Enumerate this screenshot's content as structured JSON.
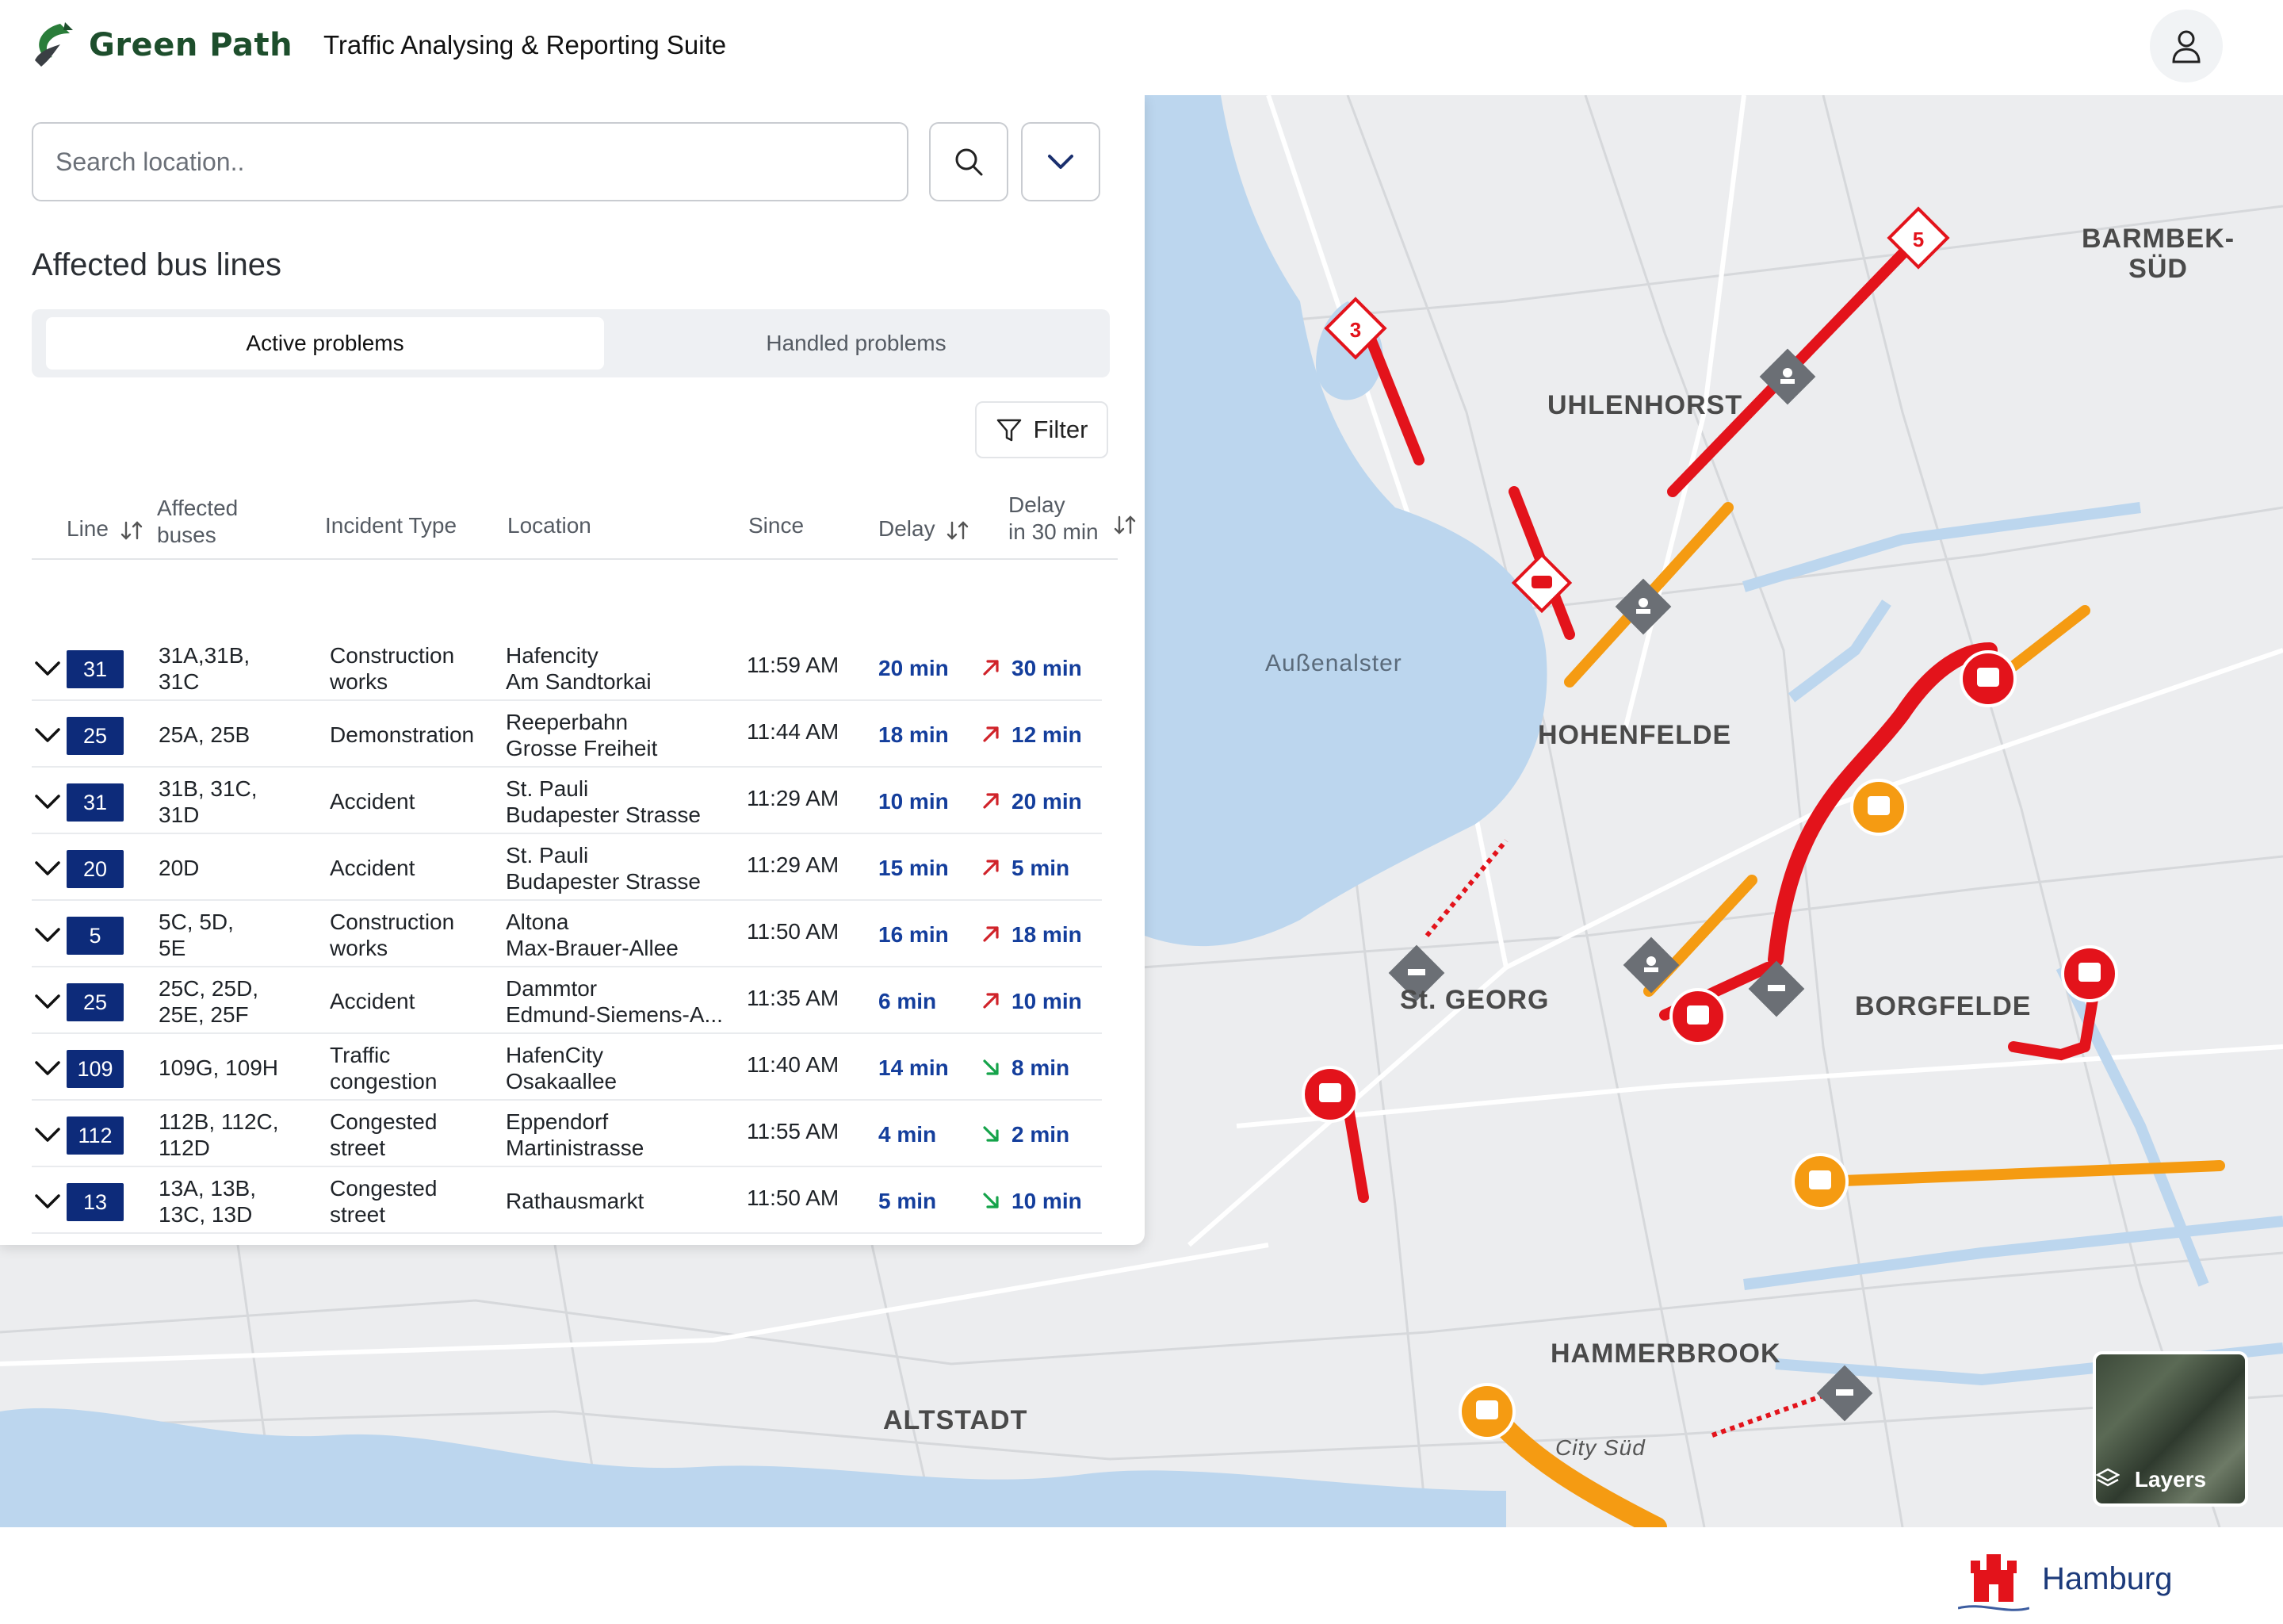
{
  "app": {
    "brand": "Green Path",
    "suite_title": "Traffic Analysing & Reporting Suite"
  },
  "search": {
    "placeholder": "Search location.."
  },
  "panel": {
    "title": "Affected bus lines",
    "tabs": [
      {
        "label": "Active problems",
        "active": true
      },
      {
        "label": "Handled problems",
        "active": false
      }
    ],
    "filter_label": "Filter"
  },
  "table": {
    "headers": {
      "line": "Line",
      "affected": "Affected\nbuses",
      "incident": "Incident Type",
      "location": "Location",
      "since": "Since",
      "delay": "Delay",
      "delay30": "Delay\nin 30 min"
    },
    "rows": [
      {
        "line": "31",
        "affected": "31A,31B,\n31C",
        "incident": "Construction\nworks",
        "location": "Hafencity\nAm Sandtorkai",
        "since": "11:59 AM",
        "delay": "20 min",
        "trend": "up",
        "delay30": "30 min"
      },
      {
        "line": "25",
        "affected": "25A, 25B",
        "incident": "Demonstration",
        "location": "Reeperbahn\nGrosse Freiheit",
        "since": "11:44 AM",
        "delay": "18 min",
        "trend": "up",
        "delay30": "12 min"
      },
      {
        "line": "31",
        "affected": "31B, 31C,\n31D",
        "incident": "Accident",
        "location": "St. Pauli\nBudapester Strasse",
        "since": "11:29 AM",
        "delay": "10 min",
        "trend": "up",
        "delay30": "20 min"
      },
      {
        "line": "20",
        "affected": "20D",
        "incident": "Accident",
        "location": "St. Pauli\nBudapester Strasse",
        "since": "11:29 AM",
        "delay": "15 min",
        "trend": "up",
        "delay30": "5 min"
      },
      {
        "line": "5",
        "affected": "5C, 5D,\n5E",
        "incident": "Construction\nworks",
        "location": "Altona\nMax-Brauer-Allee",
        "since": "11:50 AM",
        "delay": "16 min",
        "trend": "up",
        "delay30": "18 min"
      },
      {
        "line": "25",
        "affected": "25C, 25D,\n25E, 25F",
        "incident": "Accident",
        "location": "Dammtor\nEdmund-Siemens-A...",
        "since": "11:35 AM",
        "delay": "6 min",
        "trend": "up",
        "delay30": "10 min"
      },
      {
        "line": "109",
        "affected": "109G, 109H",
        "incident": "Traffic\ncongestion",
        "location": "HafenCity\nOsakaallee",
        "since": "11:40 AM",
        "delay": "14 min",
        "trend": "down",
        "delay30": "8 min"
      },
      {
        "line": "112",
        "affected": "112B, 112C,\n112D",
        "incident": "Congested\nstreet",
        "location": "Eppendorf\nMartinistrasse",
        "since": "11:55 AM",
        "delay": "4 min",
        "trend": "down",
        "delay30": "2 min"
      },
      {
        "line": "13",
        "affected": "13A, 13B,\n13C, 13D",
        "incident": "Congested\nstreet",
        "location": "Rathausmarkt",
        "since": "11:50 AM",
        "delay": "5 min",
        "trend": "down",
        "delay30": "10 min"
      }
    ]
  },
  "map": {
    "labels": {
      "uhlenhorst": "UHLENHORST",
      "barmbek": "BARMBEK-\nSÜD",
      "hohenfelde": "HOHENFELDE",
      "st_georg": "St. GEORG",
      "borgfelde": "BORGFELDE",
      "hammerbrook": "HAMMERBROOK",
      "altstadt": "ALTSTADT",
      "aussenalster": "Außenalster",
      "city_sued": "City Süd"
    },
    "markers": [
      {
        "type": "diamond",
        "label": "3"
      },
      {
        "type": "diamond",
        "label": "5"
      }
    ],
    "layers_label": "Layers",
    "colors": {
      "severe": "#e3131b",
      "moderate": "#f59b12",
      "water": "#bcd6ee"
    }
  },
  "footer": {
    "city": "Hamburg"
  },
  "colors": {
    "brand": "#1d4e2c",
    "badge": "#0d2b7a",
    "delay": "#143e9c",
    "trend_up": "#d0232a",
    "trend_down": "#15a34a"
  }
}
